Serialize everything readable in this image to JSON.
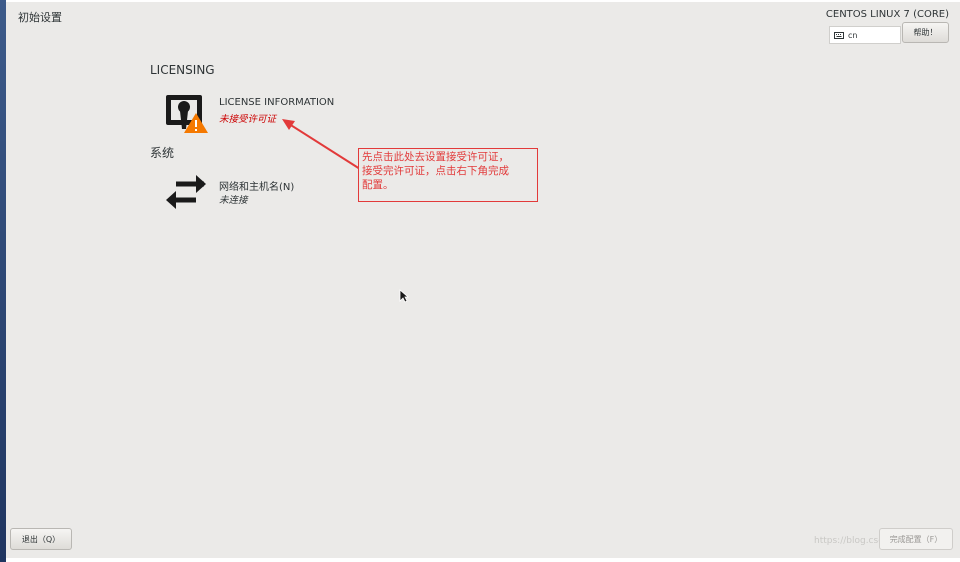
{
  "header": {
    "title": "初始设置",
    "product": "CENTOS LINUX 7 (CORE)",
    "keyboard_layout": "cn",
    "help_label": "帮助！"
  },
  "sections": {
    "licensing_title": "LICENSING",
    "system_title": "系统"
  },
  "spokes": {
    "license": {
      "title": "LICENSE INFORMATION",
      "status": "未接受许可证",
      "status_color": "#cc0000"
    },
    "network": {
      "title": "网络和主机名(N)",
      "status": "未连接",
      "status_color": "#2e3436"
    }
  },
  "annotation": {
    "text_line1": "先点击此处去设置接受许可证，",
    "text_line2": "接受完许可证，点击右下角完成",
    "text_line3": "配置。",
    "color": "#e23a3a"
  },
  "footer": {
    "quit_label": "退出（Q）",
    "finish_label": "完成配置（F）",
    "watermark": "https://blog.csdn.net/..."
  },
  "icons": {
    "license": "license-warning-icon",
    "network": "network-arrows-icon",
    "keyboard": "keyboard-icon",
    "cursor": "mouse-pointer-icon"
  }
}
